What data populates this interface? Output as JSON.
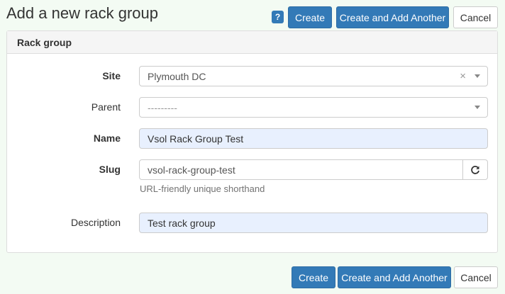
{
  "header": {
    "title": "Add a new rack group",
    "help_label": "?",
    "create_label": "Create",
    "create_another_label": "Create and Add Another",
    "cancel_label": "Cancel"
  },
  "panel": {
    "heading": "Rack group",
    "fields": {
      "site": {
        "label": "Site",
        "value": "Plymouth DC",
        "clear_symbol": "×"
      },
      "parent": {
        "label": "Parent",
        "placeholder": "---------"
      },
      "name": {
        "label": "Name",
        "value": "Vsol Rack Group Test"
      },
      "slug": {
        "label": "Slug",
        "value": "vsol-rack-group-test",
        "help": "URL-friendly unique shorthand"
      },
      "description": {
        "label": "Description",
        "value": "Test rack group"
      }
    }
  },
  "footer": {
    "create_label": "Create",
    "create_another_label": "Create and Add Another",
    "cancel_label": "Cancel"
  },
  "colors": {
    "primary": "#337ab7",
    "autofill": "#e8f0fe",
    "background": "#f3fbf3"
  },
  "icons": {
    "help": "question-icon",
    "regenerate": "refresh-icon",
    "dropdown": "chevron-down-icon"
  }
}
